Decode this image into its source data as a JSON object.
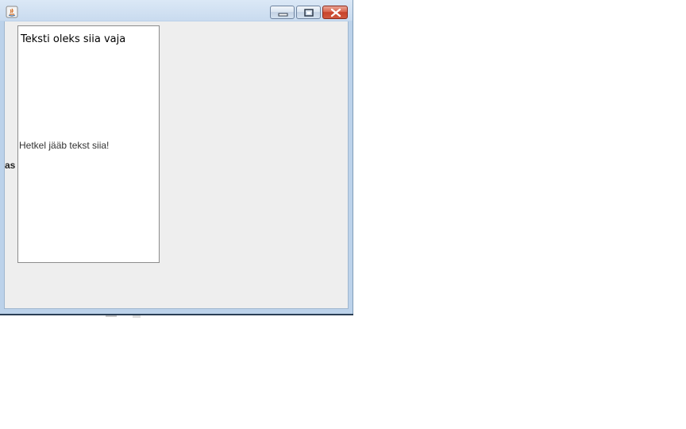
{
  "window": {
    "title": "",
    "icon": "java-icon"
  },
  "titlebar": {
    "buttons": [
      "minimize-icon",
      "maximize-icon",
      "close-icon"
    ]
  },
  "panel": {
    "top_label": "Teksti oleks siia vaja",
    "middle_label": "Hetkel jääb tekst siia!"
  },
  "clipped_label": "as",
  "colors": {
    "frame": "#bcd2ea",
    "client_bg": "#eeeeee",
    "panel_bg": "#ffffff",
    "close_red": "#c8432b"
  }
}
